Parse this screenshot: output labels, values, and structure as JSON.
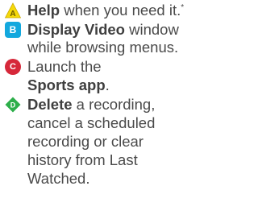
{
  "items": [
    {
      "badge_letter": "A",
      "badge_shape": "triangle",
      "badge_color": "#f5d90a",
      "lines": [
        {
          "bold": "Help",
          "normal": " when you need it.",
          "sup": "*"
        }
      ]
    },
    {
      "badge_letter": "B",
      "badge_shape": "square",
      "badge_color": "#13a8de",
      "lines": [
        {
          "bold": "Display Video",
          "normal": " window"
        },
        {
          "normal": "while browsing menus."
        }
      ]
    },
    {
      "badge_letter": "C",
      "badge_shape": "circle",
      "badge_color": "#d6283a",
      "lines": [
        {
          "normal": "Launch the"
        },
        {
          "bold": "Sports app",
          "normal": "."
        }
      ]
    },
    {
      "badge_letter": "D",
      "badge_shape": "diamond",
      "badge_color": "#2dae4a",
      "lines": [
        {
          "bold": "Delete",
          "normal": " a recording,"
        },
        {
          "normal": "cancel a scheduled"
        },
        {
          "normal": "recording or clear"
        },
        {
          "normal": "history from Last"
        },
        {
          "normal": "Watched."
        }
      ]
    }
  ]
}
